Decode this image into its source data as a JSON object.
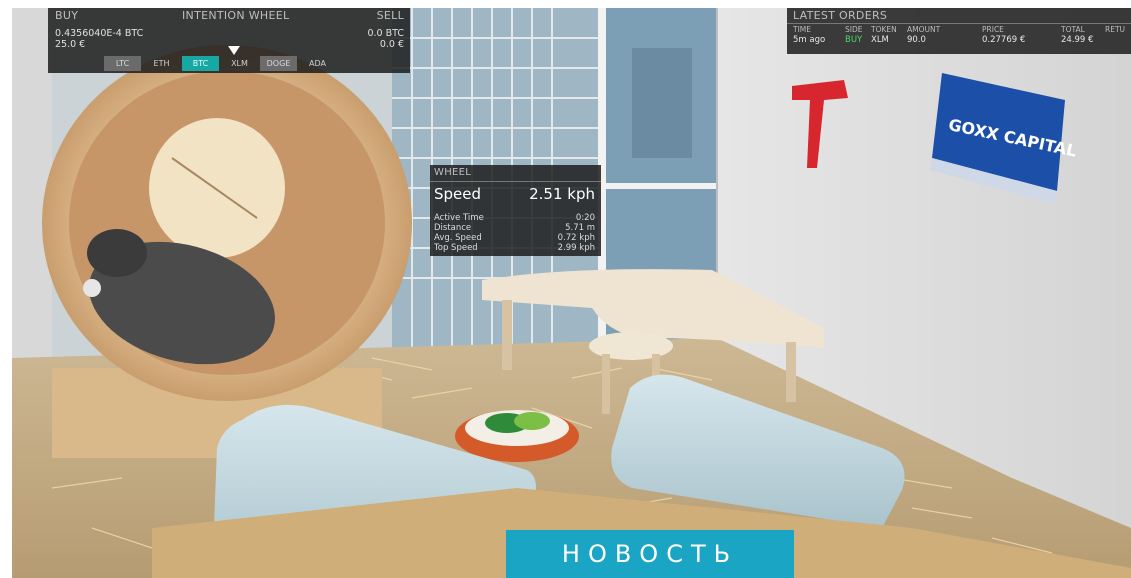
{
  "intention_wheel": {
    "buy_label": "BUY",
    "title": "INTENTION WHEEL",
    "sell_label": "SELL",
    "buy_amount": "0.4356040E-4 BTC",
    "buy_value": "25.0 €",
    "sell_amount": "0.0 BTC",
    "sell_value": "0.0 €",
    "tabs": [
      {
        "label": "LTC",
        "state": "gray"
      },
      {
        "label": "ETH",
        "state": "normal"
      },
      {
        "label": "BTC",
        "state": "active"
      },
      {
        "label": "XLM",
        "state": "normal"
      },
      {
        "label": "DOGE",
        "state": "gray"
      },
      {
        "label": "ADA",
        "state": "normal"
      }
    ]
  },
  "wheel_stats": {
    "title": "WHEEL",
    "speed_label": "Speed",
    "speed_value": "2.51 kph",
    "rows": [
      {
        "label": "Active Time",
        "value": "0:20"
      },
      {
        "label": "Distance",
        "value": "5.71 m"
      },
      {
        "label": "Avg. Speed",
        "value": "0.72 kph"
      },
      {
        "label": "Top Speed",
        "value": "2.99 kph"
      }
    ]
  },
  "latest_orders": {
    "title": "LATEST ORDERS",
    "columns": [
      "TIME",
      "SIDE",
      "TOKEN",
      "AMOUNT",
      "PRICE",
      "TOTAL",
      "RETU"
    ],
    "row": {
      "time": "5m ago",
      "side": "BUY",
      "token": "XLM",
      "amount": "90.0",
      "price": "0.27769 €",
      "total": "24.99 €"
    }
  },
  "sign": {
    "brand": "GOXX CAPITAL"
  },
  "news_banner": {
    "label": "НОВОСТЬ"
  },
  "colors": {
    "accent_teal": "#17a8a4",
    "buy_green": "#4cd964",
    "banner_blue": "#1aa5c4",
    "sign_blue": "#1c4fa8"
  }
}
